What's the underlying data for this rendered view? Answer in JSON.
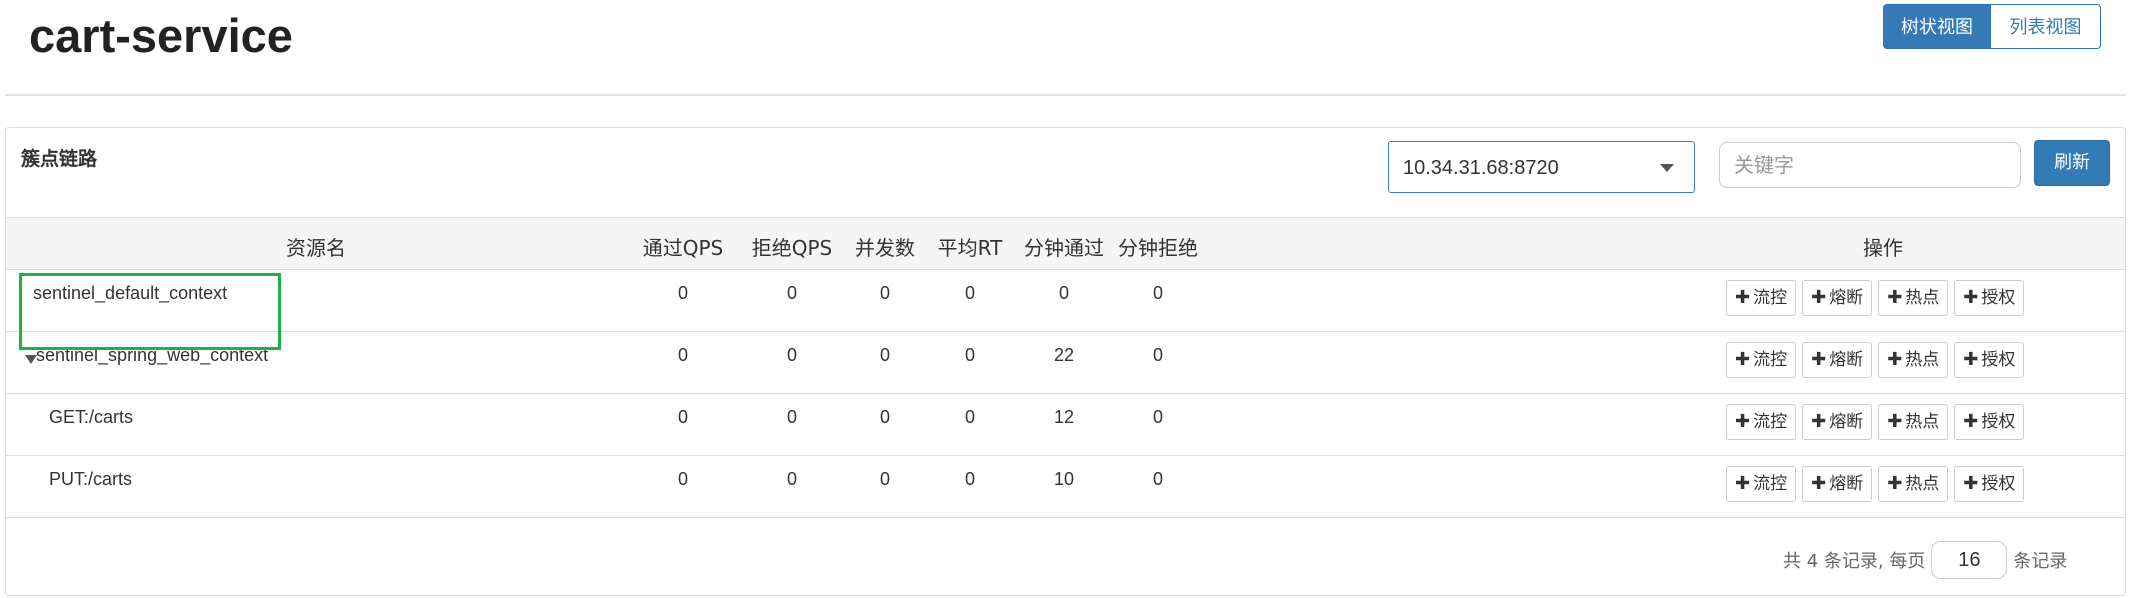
{
  "header": {
    "title": "cart-service",
    "view_tabs": [
      {
        "label": "树状视图",
        "active": true
      },
      {
        "label": "列表视图",
        "active": false
      }
    ]
  },
  "panel": {
    "title": "簇点链路",
    "machine_select": {
      "selected": "10.34.31.68:8720"
    },
    "search": {
      "placeholder": "关键字",
      "value": ""
    },
    "refresh_label": "刷新"
  },
  "table": {
    "columns": [
      "资源名",
      "通过QPS",
      "拒绝QPS",
      "并发数",
      "平均RT",
      "分钟通过",
      "分钟拒绝",
      "操作"
    ],
    "rows": [
      {
        "name": "sentinel_default_context",
        "level": 0,
        "expanded": false,
        "pass_qps": "0",
        "block_qps": "0",
        "threads": "0",
        "avg_rt": "0",
        "minute_pass": "0",
        "minute_block": "0"
      },
      {
        "name": "sentinel_spring_web_context",
        "level": 0,
        "expanded": true,
        "pass_qps": "0",
        "block_qps": "0",
        "threads": "0",
        "avg_rt": "0",
        "minute_pass": "22",
        "minute_block": "0"
      },
      {
        "name": "GET:/carts",
        "level": 1,
        "pass_qps": "0",
        "block_qps": "0",
        "threads": "0",
        "avg_rt": "0",
        "minute_pass": "12",
        "minute_block": "0"
      },
      {
        "name": "PUT:/carts",
        "level": 1,
        "pass_qps": "0",
        "block_qps": "0",
        "threads": "0",
        "avg_rt": "0",
        "minute_pass": "10",
        "minute_block": "0"
      }
    ],
    "actions": [
      "流控",
      "熔断",
      "热点",
      "授权"
    ],
    "action_icon": "plus-icon"
  },
  "pagination": {
    "prefix": "共 4 条记录, 每页",
    "page_size": "16",
    "suffix": "条记录"
  },
  "colors": {
    "primary": "#337ab7",
    "highlight": "#1fb04a"
  }
}
